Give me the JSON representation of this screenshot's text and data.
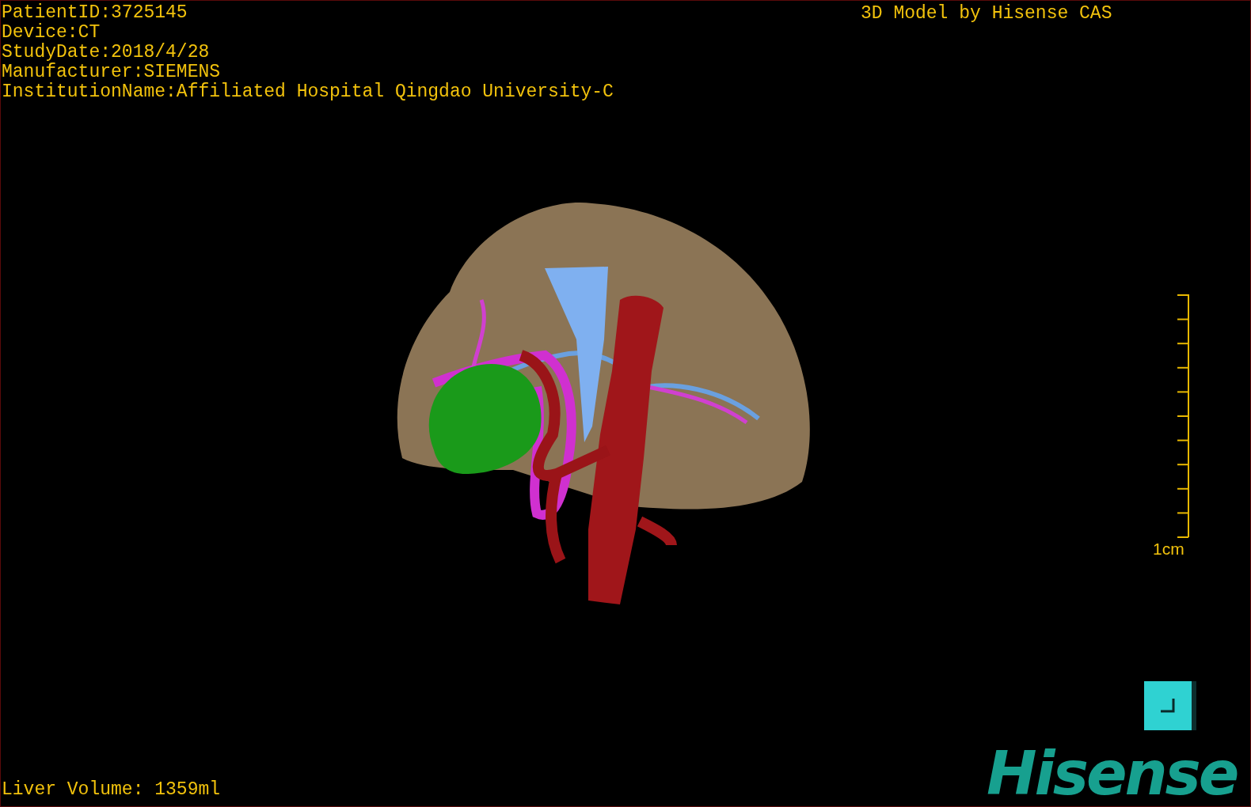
{
  "info_lines": [
    "PatientID:3725145",
    "Device:CT",
    "StudyDate:2018/4/28",
    "Manufacturer:SIEMENS",
    "InstitutionName:Affiliated Hospital Qingdao University-C"
  ],
  "title": "3D Model by Hisense CAS",
  "scale": {
    "label": "1cm"
  },
  "volume": "Liver Volume: 1359ml",
  "logo": "Hisense"
}
